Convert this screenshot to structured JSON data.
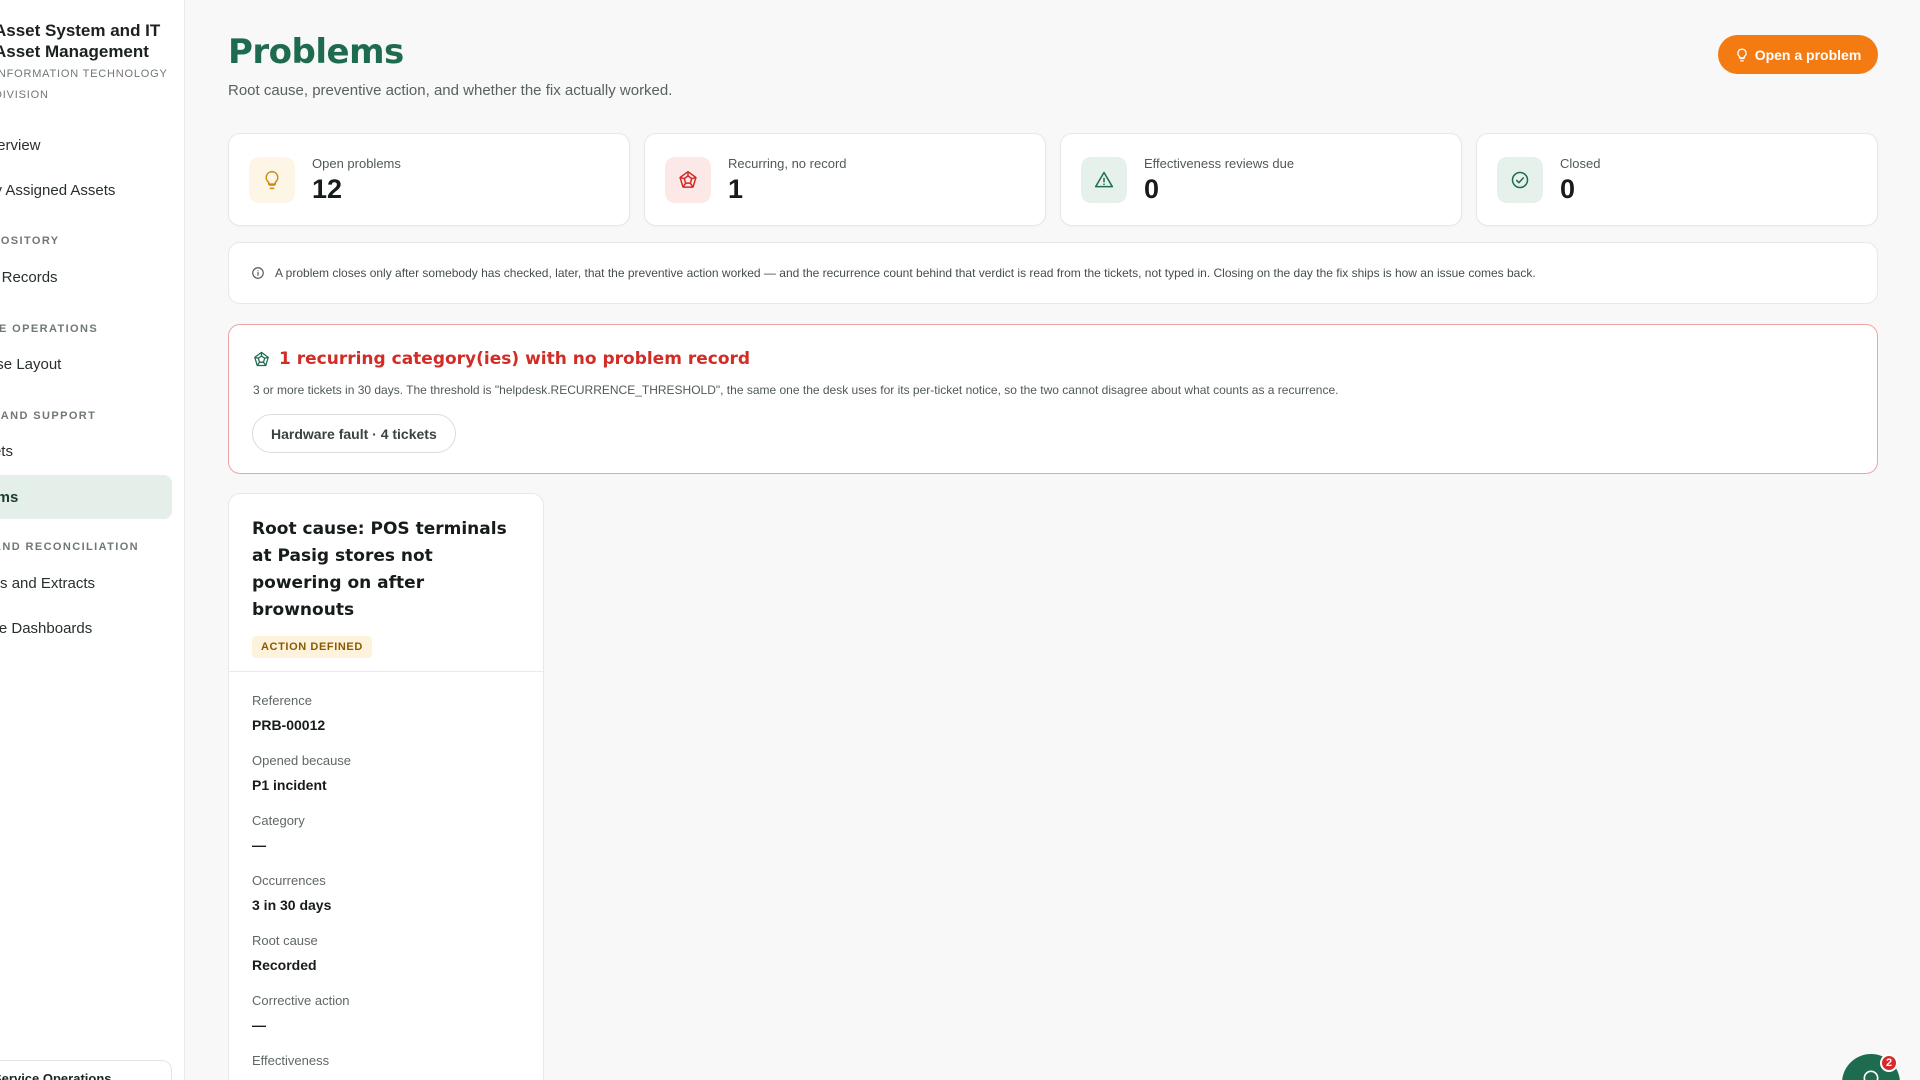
{
  "sidebar": {
    "brand_title_line1": "Asset System and IT",
    "brand_title_line2": "Asset Management",
    "brand_sub_line1": "INFORMATION TECHNOLOGY",
    "brand_sub_line2": "DIVISION",
    "items": [
      {
        "label": "Overview"
      },
      {
        "label": "My Assigned Assets"
      },
      {
        "label": "Asset Records"
      },
      {
        "label": "Warehouse Layout"
      },
      {
        "label": "Tickets"
      },
      {
        "label": "Problems",
        "active": true
      },
      {
        "label": "Reports and Extracts"
      },
      {
        "label": "Module Dashboards"
      }
    ],
    "sections": [
      "REPOSITORY",
      "WAREHOUSE OPERATIONS",
      "HELP AND SUPPORT",
      "REPORTS AND RECONCILIATION"
    ],
    "footer_label": "Service Operations"
  },
  "header": {
    "title": "Problems",
    "subtitle": "Root cause, preventive action, and whether the fix actually worked.",
    "open_button_label": "Open a problem"
  },
  "stats": [
    {
      "label": "Open problems",
      "value": "12",
      "icon": "lightbulb-icon",
      "bg": "#fdf6e6",
      "color": "#c98a0c"
    },
    {
      "label": "Recurring, no record",
      "value": "1",
      "icon": "recurring-icon",
      "bg": "#fde8e8",
      "color": "#d12c26"
    },
    {
      "label": "Effectiveness reviews due",
      "value": "0",
      "icon": "warning-icon",
      "bg": "#e6f1ec",
      "color": "#1e6b4f"
    },
    {
      "label": "Closed",
      "value": "0",
      "icon": "check-circle-icon",
      "bg": "#e6f1ec",
      "color": "#1e6b4f"
    }
  ],
  "info_text": "A problem closes only after somebody has checked, later, that the preventive action worked — and the recurrence count behind that verdict is read from the tickets, not typed in. Closing on the day the fix ships is how an issue comes back.",
  "alert": {
    "title": "1 recurring category(ies) with no problem record",
    "description": "3 or more tickets in 30 days. The threshold is \"helpdesk.RECURRENCE_THRESHOLD\", the same one the desk uses for its per-ticket notice, so the two cannot disagree about what counts as a recurrence.",
    "chip_label": "Hardware fault · 4 tickets"
  },
  "problem_card": {
    "title": "Root cause: POS terminals at Pasig stores not powering on after brownouts",
    "badge": "ACTION DEFINED",
    "fields": [
      {
        "label": "Reference",
        "value": "PRB-00012"
      },
      {
        "label": "Opened because",
        "value": "P1 incident"
      },
      {
        "label": "Category",
        "value": "—"
      },
      {
        "label": "Occurrences",
        "value": "3 in 30 days"
      },
      {
        "label": "Root cause",
        "value": "Recorded"
      },
      {
        "label": "Corrective action",
        "value": "—"
      },
      {
        "label": "Effectiveness",
        "value": ""
      }
    ]
  },
  "chat": {
    "badge_count": "2"
  },
  "colors": {
    "accent": "#1e6b4f",
    "button": "#f47a12",
    "alert": "#d12c26"
  }
}
